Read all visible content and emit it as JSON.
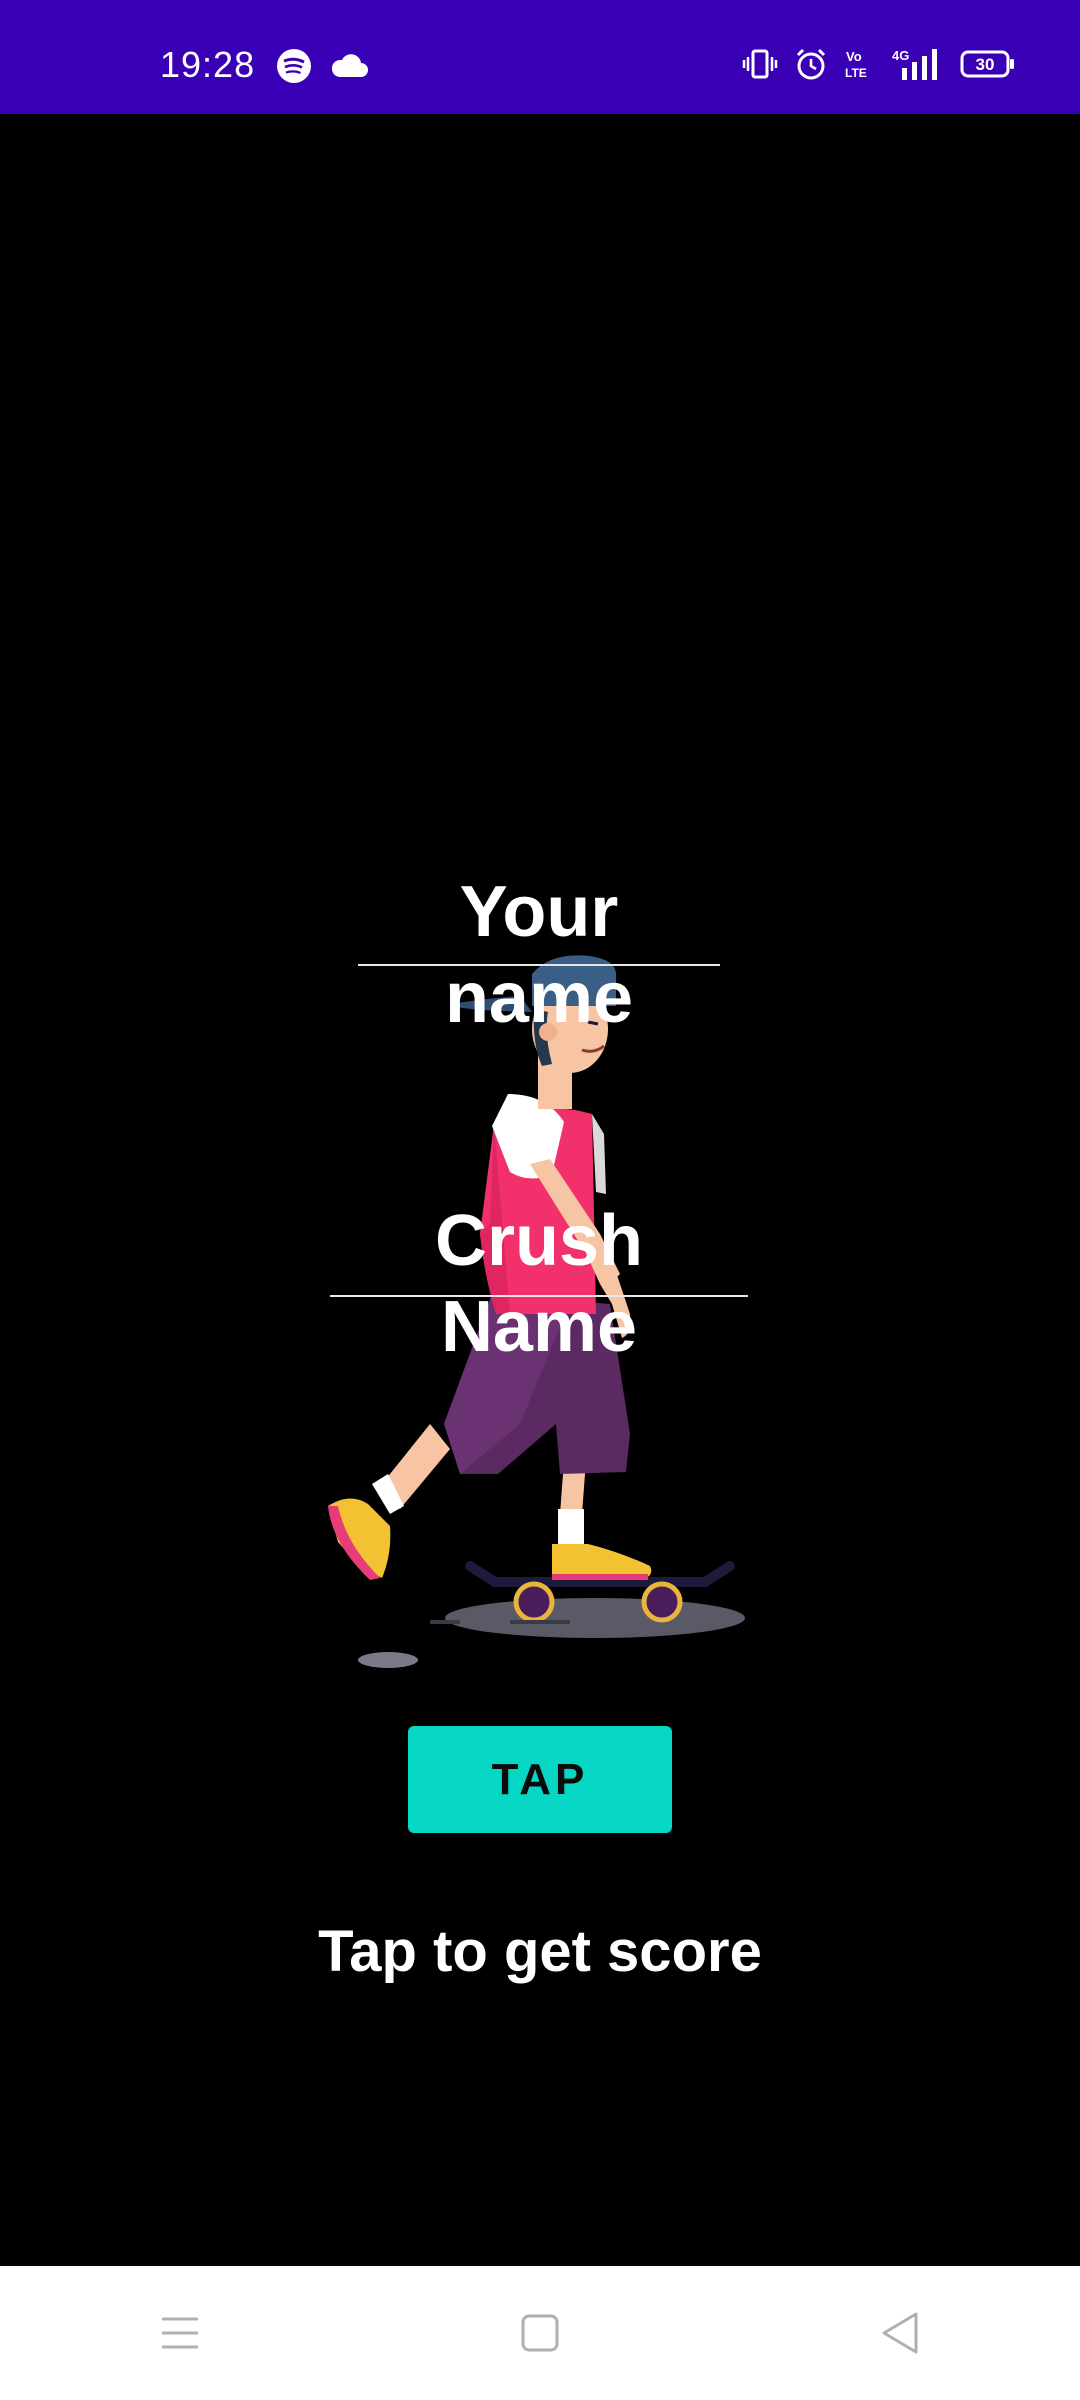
{
  "status_bar": {
    "time": "19:28",
    "battery": "30",
    "left_icons": [
      "spotify-icon",
      "cloud-icon"
    ],
    "right_icons": [
      "vibrate-icon",
      "alarm-icon",
      "volte-icon",
      "signal-4g-icon",
      "battery-icon"
    ],
    "network": "4G"
  },
  "form": {
    "your_name_placeholder": "Your name",
    "crush_name_placeholder": "Crush Name"
  },
  "tap_button": {
    "label": "TAP"
  },
  "score": {
    "text": "Tap to get score"
  },
  "colors": {
    "status_bar": "#3a00b6",
    "background": "#000000",
    "button": "#05d7c4"
  },
  "nav_bar": {
    "icons": [
      "menu-icon",
      "home-icon",
      "back-icon"
    ]
  }
}
